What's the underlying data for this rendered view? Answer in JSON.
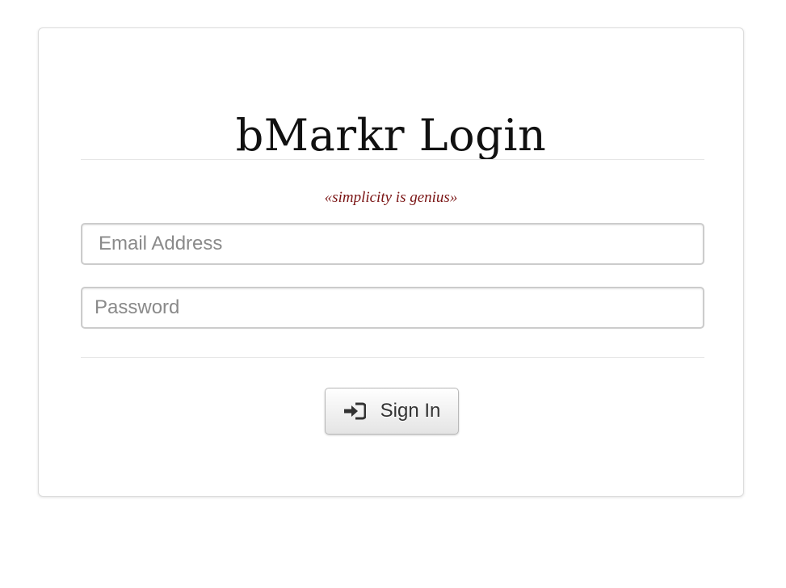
{
  "login": {
    "title": "bMarkr Login",
    "tagline": "«simplicity is genius»",
    "email_placeholder": "Email Address",
    "password_placeholder": "Password",
    "signin_label": "Sign In",
    "signin_icon": "sign-in-icon"
  }
}
